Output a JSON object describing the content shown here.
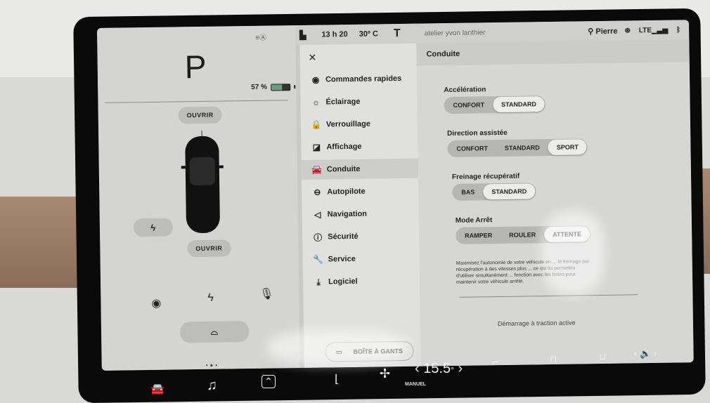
{
  "status_bar": {
    "time": "13 h 20",
    "outside_temp": "30º C",
    "map_place": "atelier yvon lanthier",
    "user": "Pierre",
    "network": "LTE"
  },
  "car_panel": {
    "gear": "P",
    "battery_percent_label": "57 %",
    "battery_level": 0.57,
    "battery_color": "#6d9c84",
    "frunk_button": "OUVRIR",
    "trunk_button": "OUVRIR",
    "charge_icon": "lightning-icon",
    "quick_icons": [
      "dashcam-icon",
      "lightning-icon",
      "microphone-icon"
    ],
    "wiper_icon": "wiper-icon"
  },
  "menu": {
    "close_icon": "close-icon",
    "items": [
      {
        "label": "Commandes rapides",
        "icon": "toggle-icon"
      },
      {
        "label": "Éclairage",
        "icon": "light-bulb-icon"
      },
      {
        "label": "Verrouillage",
        "icon": "lock-icon"
      },
      {
        "label": "Affichage",
        "icon": "display-icon"
      },
      {
        "label": "Conduite",
        "icon": "car-icon",
        "active": true
      },
      {
        "label": "Autopilote",
        "icon": "steering-wheel-icon"
      },
      {
        "label": "Navigation",
        "icon": "navigation-arrow-icon"
      },
      {
        "label": "Sécurité",
        "icon": "alert-icon"
      },
      {
        "label": "Service",
        "icon": "wrench-icon"
      },
      {
        "label": "Logiciel",
        "icon": "download-icon"
      }
    ],
    "glovebox_button": "BOÎTE À GANTS"
  },
  "content": {
    "title": "Conduite",
    "settings": [
      {
        "label": "Accélération",
        "options": [
          "CONFORT",
          "STANDARD"
        ],
        "selected": "STANDARD"
      },
      {
        "label": "Direction assistée",
        "options": [
          "CONFORT",
          "STANDARD",
          "SPORT"
        ],
        "selected": "SPORT"
      },
      {
        "label": "Freinage récupératif",
        "options": [
          "BAS",
          "STANDARD"
        ],
        "selected": "STANDARD"
      },
      {
        "label": "Mode Arrêt",
        "options": [
          "RAMPER",
          "ROULER",
          "ATTENTE"
        ],
        "selected": "ATTENTE"
      }
    ],
    "description": "Maximisez l'autonomie de votre véhicule en ... le freinage par récupération à des vitesses plus ... ce qui lui permettra d'utiliser simultanément ... fonction avec les freins pour maintenir votre véhicule arrêté.",
    "traction_label": "Démarrage à traction active"
  },
  "bottom_bar": {
    "cabin_temp": "15.5",
    "climate_mode": "MANUEL",
    "icons": [
      "car-icon",
      "music-note-icon",
      "chevron-up-icon",
      "seat-heater-icon",
      "fan-icon",
      "seat-icon",
      "rear-defrost-icon",
      "front-defrost-icon",
      "volume-icon"
    ]
  }
}
